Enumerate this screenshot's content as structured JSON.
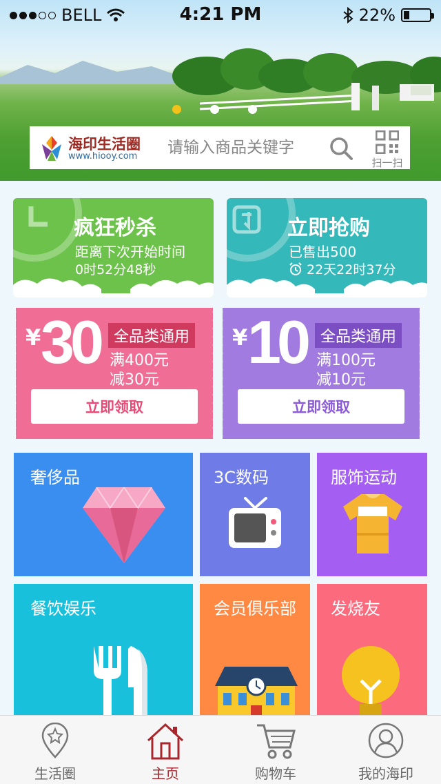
{
  "status_bar": {
    "carrier": "BELL",
    "time": "4:21 PM",
    "battery": "22%",
    "battery_level": 0.22
  },
  "search": {
    "logo_name": "海印生活圈",
    "logo_url": "www.hiooy.com",
    "placeholder": "请输入商品关键字",
    "scan_label": "扫一扫"
  },
  "promos": [
    {
      "title": "疯狂秒杀",
      "line1": "距离下次开始时间",
      "line2": "0时52分48秒",
      "color": "#6cc24a"
    },
    {
      "title": "立即抢购",
      "line1": "已售出500",
      "line2": "22天22时37分",
      "color": "#35b8b9"
    }
  ],
  "coupons": [
    {
      "currency": "¥",
      "amount": "30",
      "tag": "全品类通用",
      "cond1": "满400元",
      "cond2": "减30元",
      "button": "立即领取",
      "color": "#f06e96"
    },
    {
      "currency": "¥",
      "amount": "10",
      "tag": "全品类通用",
      "cond1": "满100元",
      "cond2": "减10元",
      "button": "立即领取",
      "color": "#a27be0"
    }
  ],
  "categories": [
    {
      "label": "奢侈品",
      "icon": "diamond-icon",
      "color": "#3a8ef0"
    },
    {
      "label": "3C数码",
      "icon": "tv-icon",
      "color": "#6f7be6"
    },
    {
      "label": "服饰运动",
      "icon": "tshirt-icon",
      "color": "#a45ff2"
    },
    {
      "label": "餐饮娱乐",
      "icon": "cutlery-icon",
      "color": "#19c0dc"
    },
    {
      "label": "会员俱乐部",
      "icon": "clubhouse-icon",
      "color": "#ff8843"
    },
    {
      "label": "发烧友",
      "icon": "lightbulb-icon",
      "color": "#fb6a7d"
    }
  ],
  "tabs": [
    {
      "label": "生活圈",
      "icon": "map-pin-star-icon",
      "active": false
    },
    {
      "label": "主页",
      "icon": "home-icon",
      "active": true
    },
    {
      "label": "购物车",
      "icon": "cart-icon",
      "active": false
    },
    {
      "label": "我的海印",
      "icon": "user-icon",
      "active": false
    }
  ],
  "active_tab_color": "#a8262c"
}
